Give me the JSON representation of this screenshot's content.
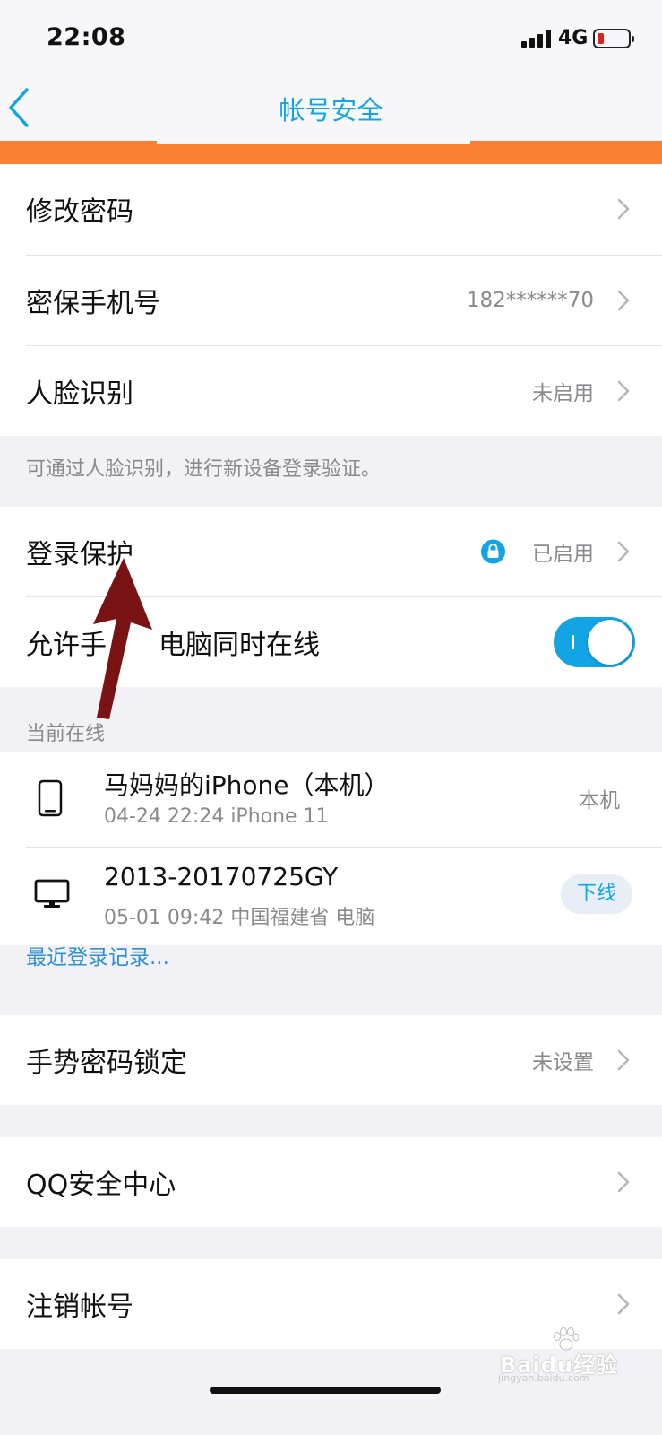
{
  "status_bar": {
    "time": "22:08",
    "network": "4G"
  },
  "nav": {
    "title": "帐号安全"
  },
  "colors": {
    "accent": "#12a4e4",
    "banner": "#fd7f34",
    "arrow": "#7a1414"
  },
  "icons": [
    "chevron-left-icon",
    "chevron-right-icon",
    "lock-icon",
    "phone-icon",
    "monitor-icon",
    "signal-icon",
    "battery-icon"
  ],
  "section1": {
    "rows": [
      {
        "label": "修改密码",
        "value": ""
      },
      {
        "label": "密保手机号",
        "value": "182******70"
      },
      {
        "label": "人脸识别",
        "value": "未启用"
      }
    ],
    "note": "可通过人脸识别，进行新设备登录验证。"
  },
  "section2": {
    "login_protect": {
      "label": "登录保护",
      "value": "已启用"
    },
    "toggle_row": {
      "label_left": "允许手",
      "label_right": "电脑同时在线",
      "on": true
    }
  },
  "online": {
    "header": "当前在线",
    "devices": [
      {
        "name": "马妈妈的iPhone（本机）",
        "meta": "04-24 22:24  iPhone 11",
        "tag": "本机"
      },
      {
        "name": "2013-20170725GY",
        "meta": "05-01 09:42 中国福建省 电脑",
        "action": "下线"
      }
    ],
    "recent_link": "最近登录记录..."
  },
  "gesture": {
    "label": "手势密码锁定",
    "value": "未设置"
  },
  "qq_security": {
    "label": "QQ安全中心"
  },
  "cancel_account": {
    "label": "注销帐号"
  },
  "watermark": {
    "text": "Baidu经验",
    "sub": "jingyan.baidu.com"
  }
}
